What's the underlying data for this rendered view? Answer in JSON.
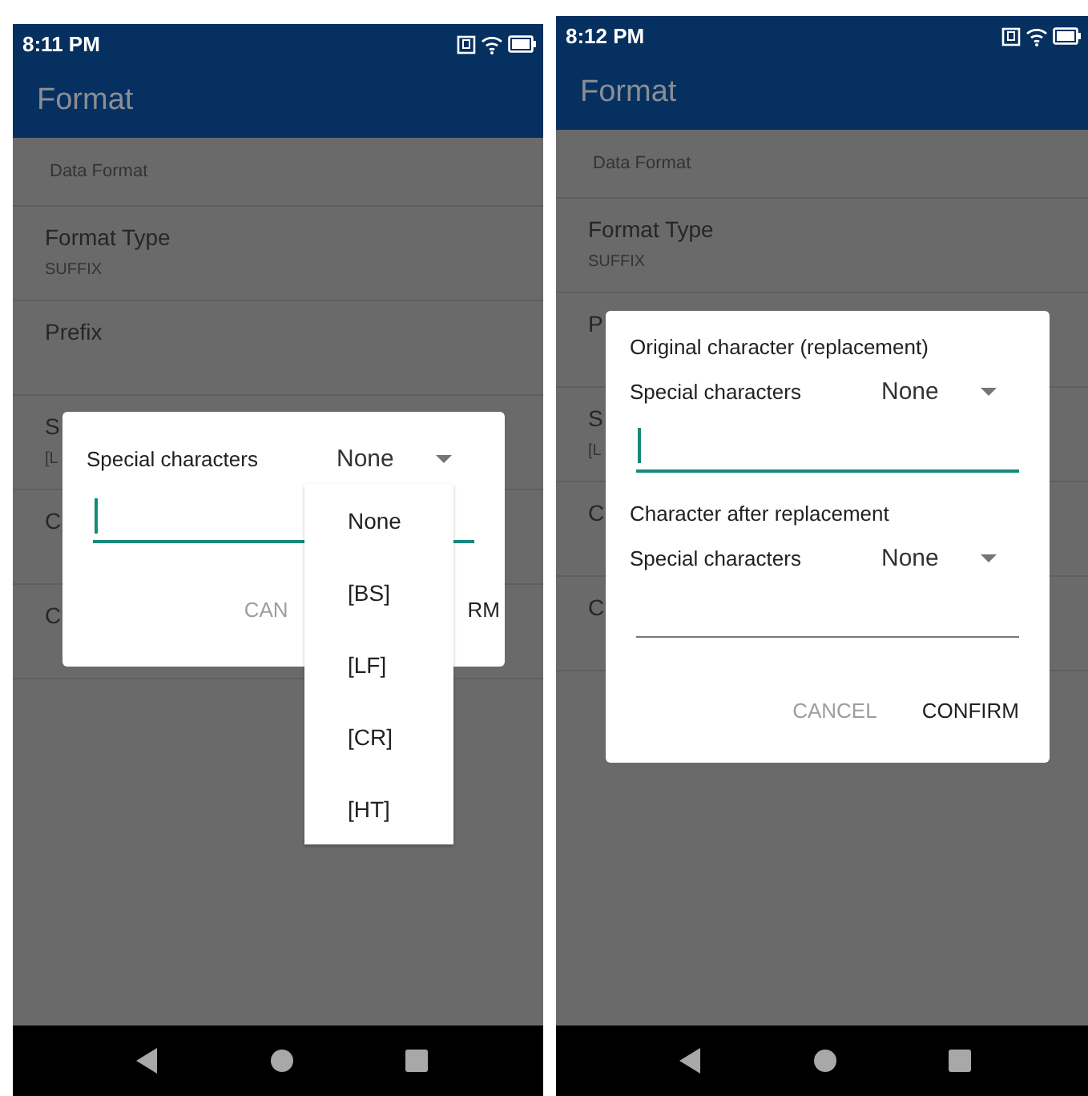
{
  "screens": [
    {
      "status_bar": {
        "time": "8:11 PM"
      },
      "app_bar": {
        "title": "Format"
      },
      "list": {
        "section_header": "Data Format",
        "items": [
          {
            "title": "Format Type",
            "subtitle": "SUFFIX"
          },
          {
            "title": "Prefix"
          },
          {
            "title": "S",
            "subtitle": "[L"
          },
          {
            "title": "C"
          },
          {
            "title": "C"
          }
        ]
      },
      "dialog": {
        "kind": "single",
        "sections": [
          {
            "kind": "picker",
            "label": "Special characters",
            "value": "None"
          },
          {
            "kind": "field",
            "focused": true
          }
        ],
        "buttons": [
          {
            "label": "CAN",
            "disabled": true
          },
          {
            "label": "RM",
            "disabled": false
          }
        ]
      },
      "dropdown": {
        "items": [
          "None",
          "[BS]",
          "[LF]",
          "[CR]",
          "[HT]"
        ]
      }
    },
    {
      "status_bar": {
        "time": "8:12 PM"
      },
      "app_bar": {
        "title": "Format"
      },
      "list": {
        "section_header": "Data Format",
        "items": [
          {
            "title": "Format Type",
            "subtitle": "SUFFIX"
          },
          {
            "title": "P"
          },
          {
            "title": "S",
            "subtitle": "[L"
          },
          {
            "title": "C"
          },
          {
            "title": "C"
          }
        ]
      },
      "dialog": {
        "kind": "double",
        "sections": [
          {
            "kind": "heading",
            "text": "Original character (replacement)"
          },
          {
            "kind": "picker",
            "label": "Special characters",
            "value": "None"
          },
          {
            "kind": "field",
            "focused": true
          },
          {
            "kind": "heading",
            "text": "Character after replacement"
          },
          {
            "kind": "picker",
            "label": "Special characters",
            "value": "None"
          },
          {
            "kind": "field",
            "focused": false
          }
        ],
        "buttons": [
          {
            "label": "CANCEL",
            "disabled": true
          },
          {
            "label": "CONFIRM",
            "disabled": false
          }
        ]
      }
    }
  ]
}
